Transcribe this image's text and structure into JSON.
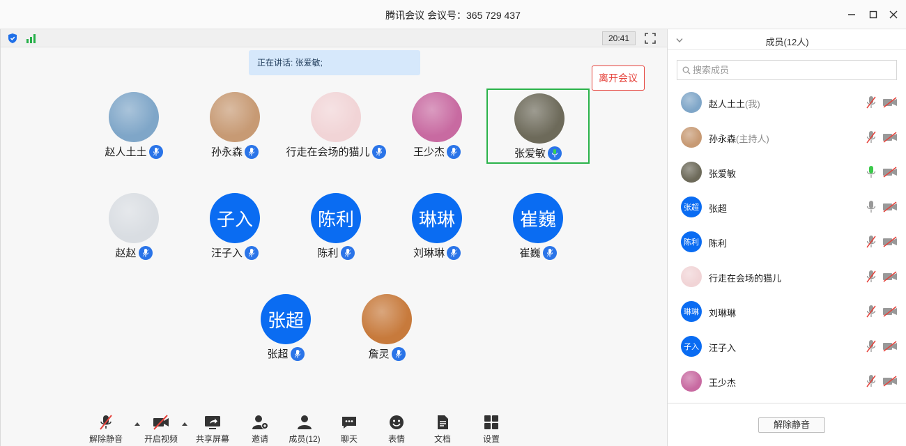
{
  "window": {
    "title": "腾讯会议 会议号：365 729 437"
  },
  "meeting": {
    "timer": "20:41",
    "speaking_text": "正在讲话: 张爱敏;"
  },
  "participants": [
    {
      "name": "赵人土土",
      "avatar": "photo",
      "color": "#7fa6c8"
    },
    {
      "name": "孙永森",
      "avatar": "photo",
      "color": "#c79a74"
    },
    {
      "name": "行走在会场的猫儿",
      "avatar": "photo",
      "color": "#f1d4d6"
    },
    {
      "name": "王少杰",
      "avatar": "photo",
      "color": "#c86aa1"
    },
    {
      "name": "张爱敏",
      "avatar": "photo",
      "color": "#6d6a5a"
    },
    {
      "name": "赵赵",
      "avatar": "photo",
      "color": "#d9dde2"
    },
    {
      "name": "汪子入",
      "avatar": "text",
      "avatar_text": "子入"
    },
    {
      "name": "陈利",
      "avatar": "text",
      "avatar_text": "陈利"
    },
    {
      "name": "刘琳琳",
      "avatar": "text",
      "avatar_text": "琳琳"
    },
    {
      "name": "崔巍",
      "avatar": "text",
      "avatar_text": "崔巍"
    },
    {
      "name": "张超",
      "avatar": "text",
      "avatar_text": "张超"
    },
    {
      "name": "詹灵",
      "avatar": "photo",
      "color": "#c77a3c"
    }
  ],
  "toolbar": {
    "unmute": "解除静音",
    "video": "开启视频",
    "share": "共享屏幕",
    "invite": "邀请",
    "members": "成员(12)",
    "chat": "聊天",
    "emoji": "表情",
    "docs": "文档",
    "settings": "设置",
    "leave": "离开会议"
  },
  "panel": {
    "title": "成员(12人)",
    "search_placeholder": "搜索成员",
    "unmute_all": "解除静音",
    "members": [
      {
        "name": "赵人土土",
        "suffix": "(我)",
        "avatar": "photo",
        "color": "#7fa6c8",
        "mic": "muted"
      },
      {
        "name": "孙永森",
        "suffix": "(主持人)",
        "avatar": "photo",
        "color": "#c79a74",
        "mic": "muted"
      },
      {
        "name": "张爱敏",
        "suffix": "",
        "avatar": "photo",
        "color": "#6d6a5a",
        "mic": "speaking"
      },
      {
        "name": "张超",
        "suffix": "",
        "avatar": "text",
        "avatar_text": "张超",
        "mic": "on"
      },
      {
        "name": "陈利",
        "suffix": "",
        "avatar": "text",
        "avatar_text": "陈利",
        "mic": "muted"
      },
      {
        "name": "行走在会场的猫儿",
        "suffix": "",
        "avatar": "photo",
        "color": "#f1d4d6",
        "mic": "muted"
      },
      {
        "name": "刘琳琳",
        "suffix": "",
        "avatar": "text",
        "avatar_text": "琳琳",
        "mic": "muted"
      },
      {
        "name": "汪子入",
        "suffix": "",
        "avatar": "text",
        "avatar_text": "子入",
        "mic": "muted"
      },
      {
        "name": "王少杰",
        "suffix": "",
        "avatar": "photo",
        "color": "#c86aa1",
        "mic": "muted"
      }
    ]
  },
  "colors": {
    "accent": "#0a6cf2",
    "speaking_border": "#2bb34a",
    "leave": "#e5413a",
    "muted_slash": "#e5413a"
  }
}
